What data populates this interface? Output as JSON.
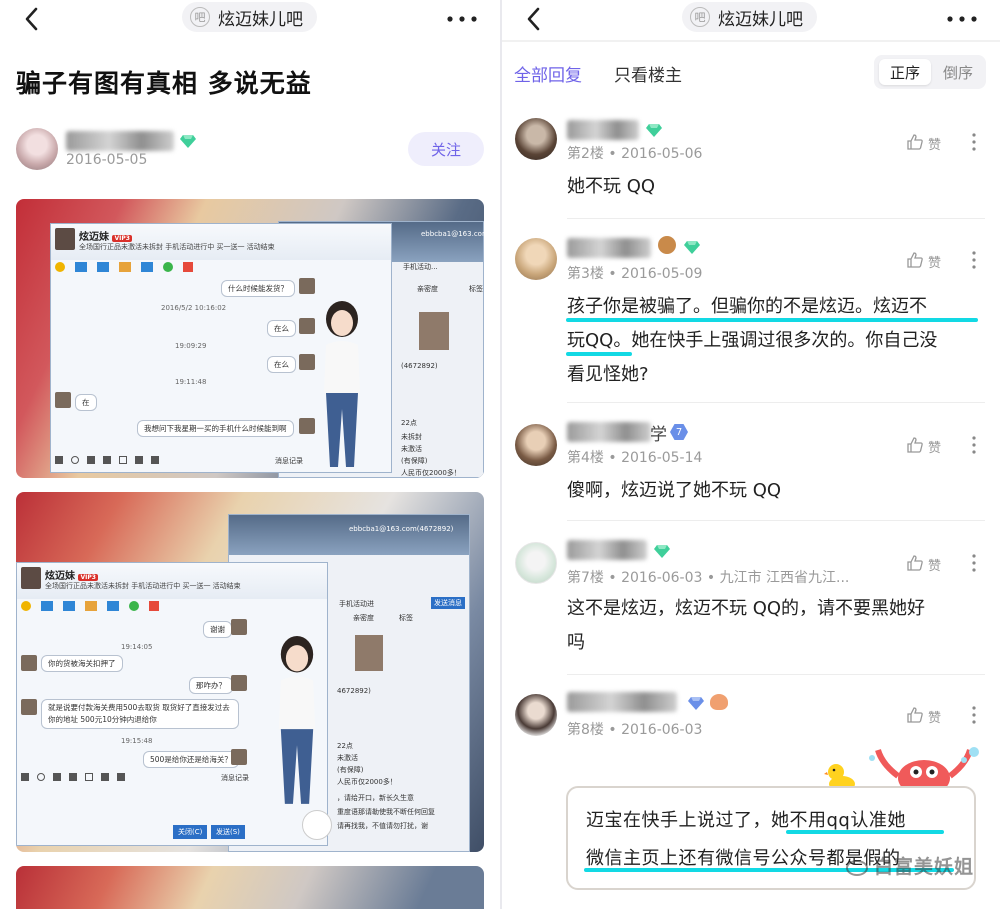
{
  "left": {
    "forum_name": "炫迈妹儿吧",
    "forum_icon_text": "吧",
    "post_title": "骗子有图有真相 多说无益",
    "author_date": "2016-05-05",
    "follow_label": "关注",
    "shot1": {
      "contact": "炫迈妹",
      "vip": "VIP3",
      "status": "全场国行正品未激活未拆封 手机活动进行中 买一送一 活动结束",
      "email": "ebbcba1@163.com(467289",
      "messages": [
        "什么时候能发货？",
        "2016/5/2 10:16:02",
        "在么",
        "19:09:29",
        "在么",
        "19:11:48",
        "在",
        "我想问下我星期一买的手机什么时候能到啊"
      ],
      "side_texts": [
        "手机活动...",
        "亲密度",
        "标签",
        "(4672892)",
        "22点",
        "未拆封",
        "未激活",
        "(有保障)",
        "人民币仅2000多！"
      ],
      "toolbar_right": "消息记录"
    },
    "shot2": {
      "contact": "炫迈妹",
      "vip": "VIP3",
      "status": "全场国行正品未激活未拆封 手机活动进行中 买一送一 活动结束",
      "email": "ebbcba1@163.com(4672892)",
      "messages": [
        "谢谢",
        "19:14:05",
        "你的货被海关扣押了",
        "那咋办？",
        "就是说要付款海关费用500去取货 取货好了直接发过去你的地址 500元10分钟内退给你",
        "19:15:48",
        "500是给你还是给海关？"
      ],
      "side_texts": [
        "手机活动进",
        "发送消息",
        "亲密度",
        "标签",
        "4672892)",
        "22点",
        "未激活",
        "(有保障)",
        "人民币仅2000多！",
        "，请给开口，新长久生意",
        "重度语那请勒使我不断任何回复",
        "请再找我，不值请勿打扰，谢"
      ],
      "buttons": [
        "关闭(C)",
        "发送(S)"
      ],
      "toolbar_right": "消息记录"
    }
  },
  "right": {
    "forum_name": "炫迈妹儿吧",
    "forum_icon_text": "吧",
    "tabs": [
      "全部回复",
      "只看楼主"
    ],
    "sort": [
      "正序",
      "倒序"
    ],
    "like_label": "赞",
    "replies": [
      {
        "floor_meta": "第2楼 • 2016-05-06",
        "text_lines": [
          "她不玩 QQ"
        ]
      },
      {
        "floor_meta": "第3楼 • 2016-05-09",
        "text_lines": [
          "孩子你是被骗了。但骗你的不是炫迈。炫迈不",
          "玩QQ。她在快手上强调过很多次的。你自己没",
          "看见怪她?"
        ]
      },
      {
        "floor_meta": "第4楼 • 2016-05-14",
        "badge": "7",
        "name_suffix": "学",
        "text_lines": [
          "傻啊，炫迈说了她不玩 QQ"
        ]
      },
      {
        "floor_meta": "第7楼 • 2016-06-03 • 九江市 江西省九江...",
        "text_lines": [
          "这不是炫迈，炫迈不玩 QQ的，请不要黑她好",
          "吗"
        ]
      },
      {
        "floor_meta": "第8楼 • 2016-06-03",
        "text_lines": []
      }
    ],
    "bubble_lines": [
      "迈宝在快手上说过了，她不用qq认准她",
      "微信主页上还有微信号公众号都是假的"
    ],
    "watermark": "白富美妖姐"
  },
  "colors": {
    "accent": "#6f63e8",
    "underline": "#12d9e4",
    "gem": "#3fcf9a"
  }
}
